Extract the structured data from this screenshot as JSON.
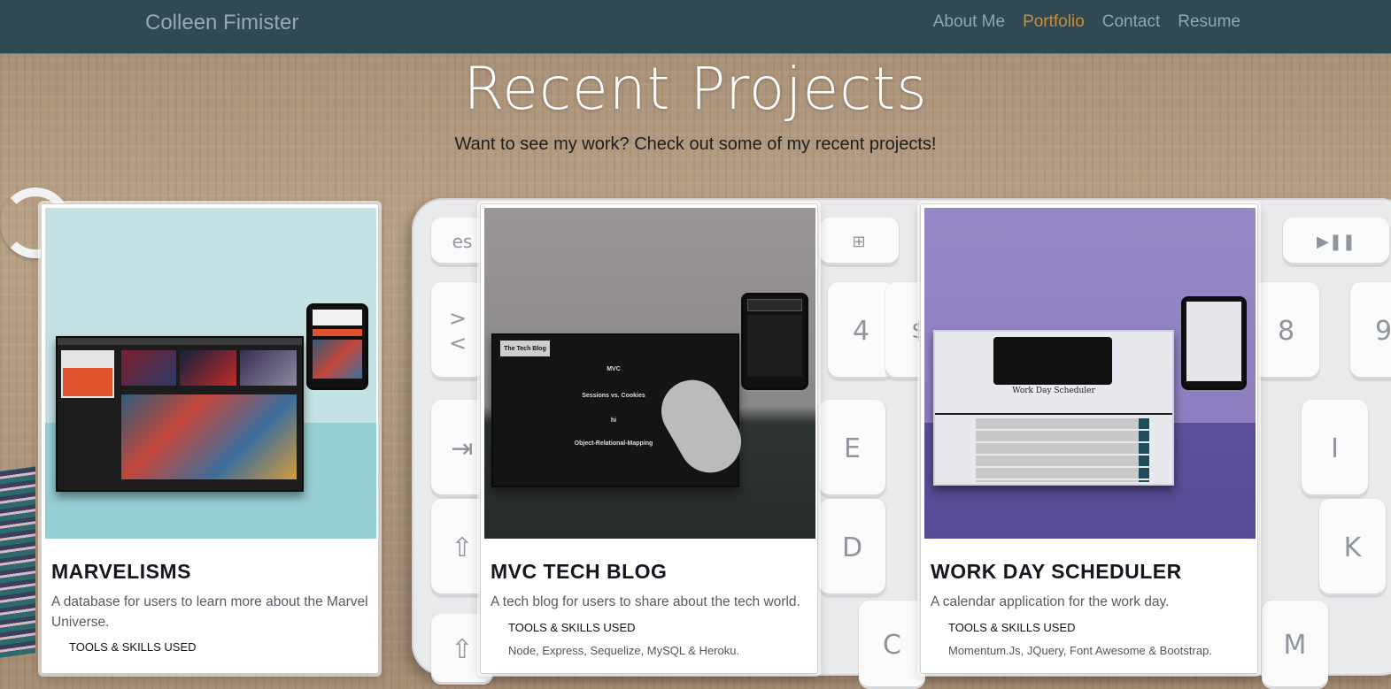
{
  "navbar": {
    "brand": "Colleen Fimister",
    "links": [
      {
        "label": "About Me",
        "active": false
      },
      {
        "label": "Portfolio",
        "active": true
      },
      {
        "label": "Contact",
        "active": false
      },
      {
        "label": "Resume",
        "active": false
      }
    ]
  },
  "hero": {
    "title": "Recent Projects",
    "subtitle": "Want to see my work? Check out some of my recent projects!"
  },
  "projects": [
    {
      "title": "MARVELISMS",
      "description": "A database for users to learn more about the Marvel Universe.",
      "tools_heading": "TOOLS & SKILLS USED",
      "tools": "",
      "bg_color": "#bcdde1"
    },
    {
      "title": "MVC TECH BLOG",
      "description": "A tech blog for users to share about the tech world.",
      "tools_heading": "TOOLS & SKILLS USED",
      "tools": "Node, Express, Sequelize, MySQL & Heroku.",
      "bg_color": "#8f8b8c",
      "preview": {
        "site_name": "The Tech Blog",
        "posts": [
          "MVC",
          "Sessions vs. Cookies",
          "hi",
          "Object-Relational-Mapping"
        ]
      }
    },
    {
      "title": "WORK DAY SCHEDULER",
      "description": "A calendar application for the work day.",
      "tools_heading": "TOOLS & SKILLS USED",
      "tools": "Momentum.Js, JQuery, Font Awesome & Bootstrap.",
      "bg_color": "#8a7cc2",
      "preview": {
        "site_name": "Work Day Scheduler"
      }
    }
  ],
  "colors": {
    "navbar_bg": "#304a51",
    "nav_link": "#93a4b8",
    "nav_active": "#c98d3b"
  }
}
